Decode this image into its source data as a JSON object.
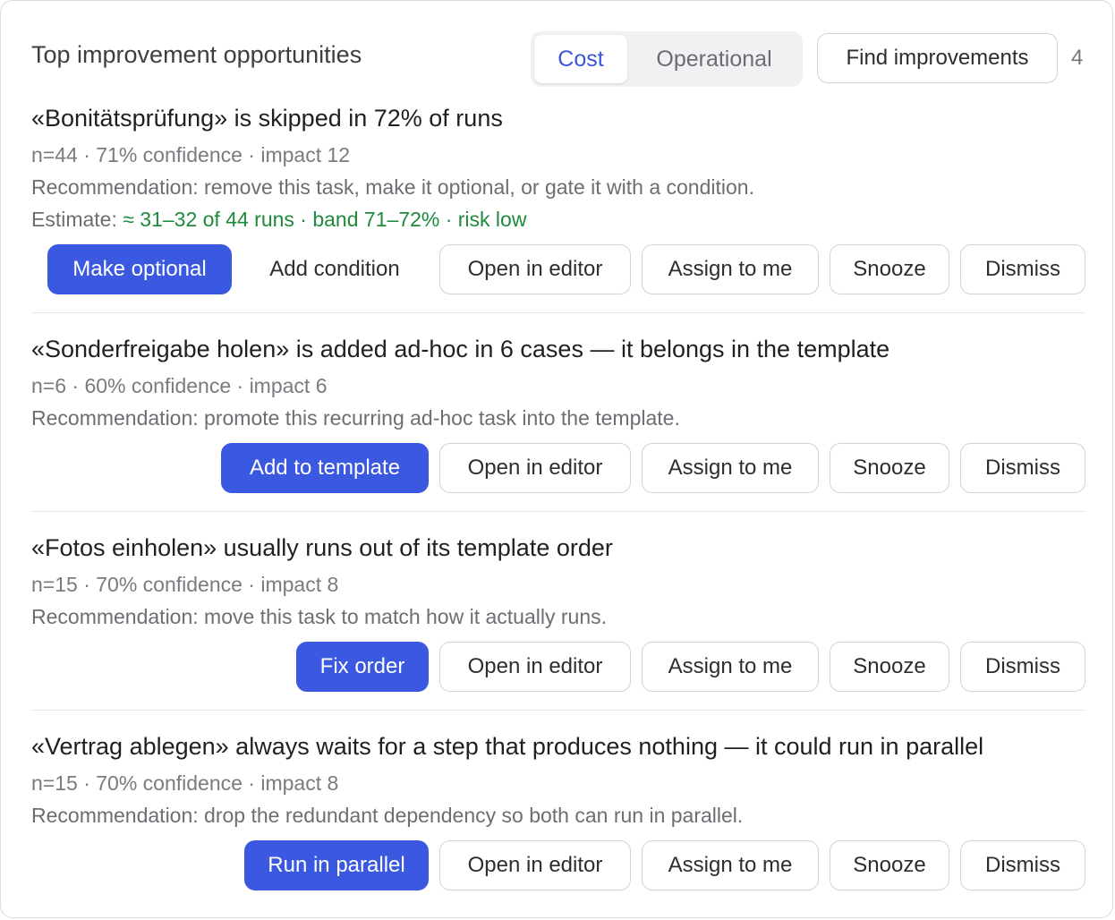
{
  "header": {
    "title": "Top improvement opportunities",
    "tabs": [
      {
        "label": "Cost",
        "active": true
      },
      {
        "label": "Operational",
        "active": false
      }
    ],
    "find_button": "Find improvements",
    "count": "4"
  },
  "colors": {
    "primary": "#3a58e0",
    "active_tab_text": "#3a54dc",
    "estimate_green": "#1e8a3c",
    "border": "#d2d2d5"
  },
  "items": [
    {
      "title": "«Bonitätsprüfung» is skipped in 72% of runs",
      "meta": "n=44 · 71% confidence · impact 12",
      "recommendation": "Recommendation: remove this task, make it optional, or gate it with a condition.",
      "estimate_label": "Estimate: ",
      "estimate_value": "≈ 31–32 of 44 runs · band 71–72% · risk low",
      "primary_action": "Make optional",
      "secondary_action": "Add condition",
      "actions": [
        "Open in editor",
        "Assign to me",
        "Snooze",
        "Dismiss"
      ]
    },
    {
      "title": "«Sonderfreigabe holen» is added ad-hoc in 6 cases — it belongs in the template",
      "meta": "n=6 · 60% confidence · impact 6",
      "recommendation": "Recommendation: promote this recurring ad-hoc task into the template.",
      "primary_action": "Add to template",
      "actions": [
        "Open in editor",
        "Assign to me",
        "Snooze",
        "Dismiss"
      ]
    },
    {
      "title": "«Fotos einholen» usually runs out of its template order",
      "meta": "n=15 · 70% confidence · impact 8",
      "recommendation": "Recommendation: move this task to match how it actually runs.",
      "primary_action": "Fix order",
      "actions": [
        "Open in editor",
        "Assign to me",
        "Snooze",
        "Dismiss"
      ]
    },
    {
      "title": "«Vertrag ablegen» always waits for a step that produces nothing — it could run in parallel",
      "meta": "n=15 · 70% confidence · impact 8",
      "recommendation": "Recommendation: drop the redundant dependency so both can run in parallel.",
      "primary_action": "Run in parallel",
      "actions": [
        "Open in editor",
        "Assign to me",
        "Snooze",
        "Dismiss"
      ]
    }
  ]
}
